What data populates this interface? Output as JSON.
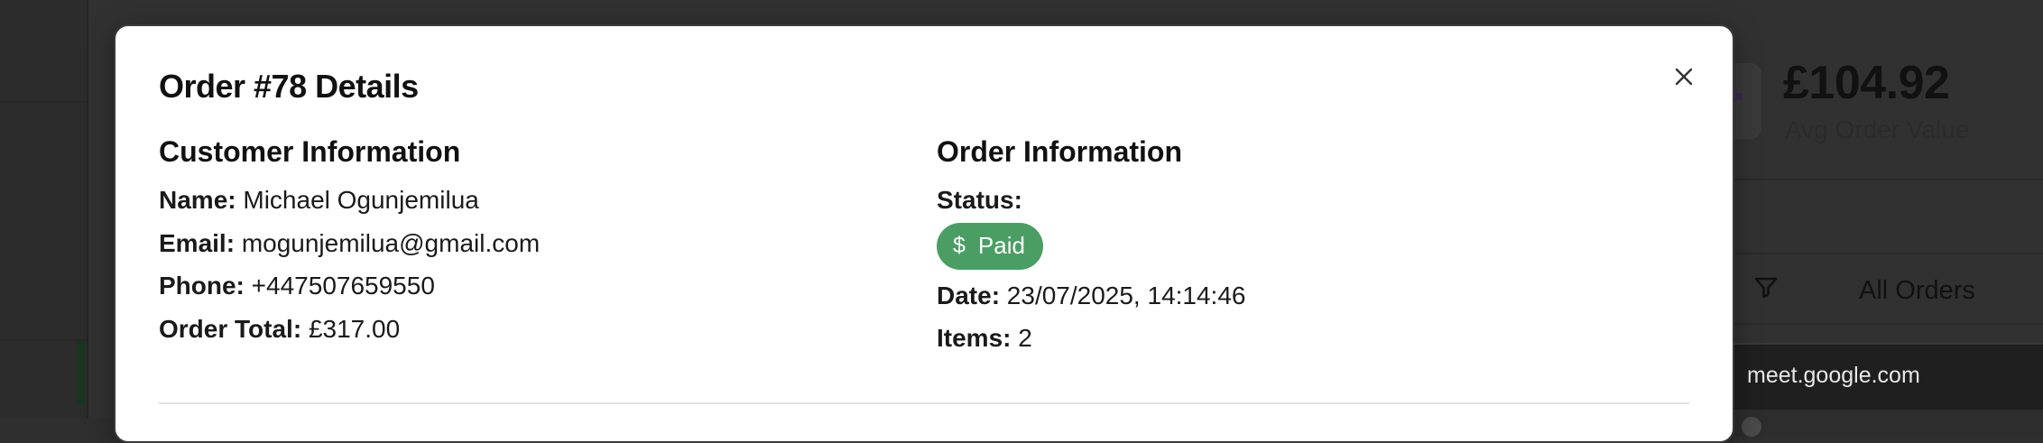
{
  "modal": {
    "title": "Order #78 Details",
    "close_icon": "close-icon"
  },
  "customer": {
    "heading": "Customer Information",
    "name_label": "Name:",
    "name_value": "Michael Ogunjemilua",
    "email_label": "Email:",
    "email_value": "mogunjemilua@gmail.com",
    "phone_label": "Phone:",
    "phone_value": "+447507659550",
    "total_label": "Order Total:",
    "total_value": "£317.00"
  },
  "order": {
    "heading": "Order Information",
    "status_label": "Status:",
    "status_value": "Paid",
    "status_icon": "$",
    "status_color": "#4a9e63",
    "date_label": "Date:",
    "date_value": "23/07/2025, 14:14:46",
    "items_label": "Items:",
    "items_value": "2"
  },
  "background": {
    "avg_order_value": "£104.92",
    "avg_order_label": "Avg Order Value",
    "filter_label": "All Orders",
    "filter_icon": "filter-icon"
  },
  "popup": {
    "host": "meet.google.com",
    "icon": "tune-icon"
  }
}
